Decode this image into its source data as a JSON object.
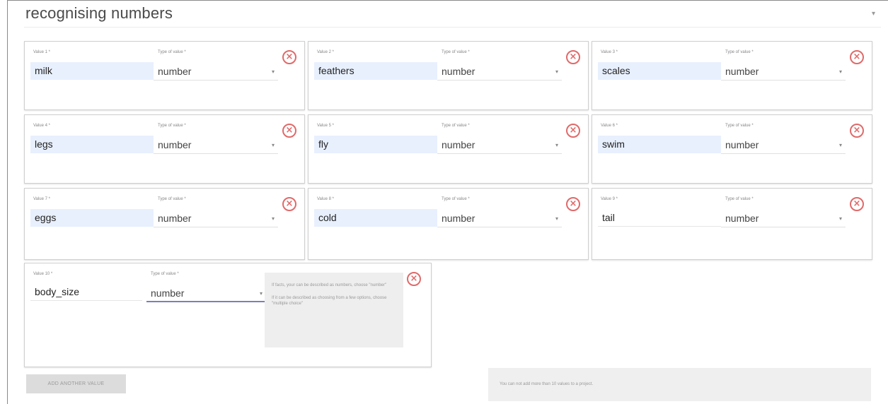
{
  "section": {
    "title": "recognising numbers",
    "collapse_icon": "▾"
  },
  "values": [
    {
      "label": "Value 1 *",
      "type_label": "Type of value *",
      "value": "milk",
      "type": "number"
    },
    {
      "label": "Value 2 *",
      "type_label": "Type of value *",
      "value": "feathers",
      "type": "number"
    },
    {
      "label": "Value 3 *",
      "type_label": "Type of value *",
      "value": "scales",
      "type": "number"
    },
    {
      "label": "Value 4 *",
      "type_label": "Type of value *",
      "value": "legs",
      "type": "number"
    },
    {
      "label": "Value 5 *",
      "type_label": "Type of value *",
      "value": "fly",
      "type": "number"
    },
    {
      "label": "Value 6 *",
      "type_label": "Type of value *",
      "value": "swim",
      "type": "number"
    },
    {
      "label": "Value 7 *",
      "type_label": "Type of value *",
      "value": "eggs",
      "type": "number"
    },
    {
      "label": "Value 8 *",
      "type_label": "Type of value *",
      "value": "cold",
      "type": "number"
    },
    {
      "label": "Value 9 *",
      "type_label": "Type of value *",
      "value": "tail",
      "type": "number"
    },
    {
      "label": "Value 10 *",
      "type_label": "Type of value *",
      "value": "body_size",
      "type": "number"
    }
  ],
  "tooltip": {
    "line1": "If facts, your can be described as numbers, choose \"number\"",
    "line2": "If it can be described as choosing from a few options, choose \"multiple choice\""
  },
  "add_button": "ADD ANOTHER VALUE",
  "notice": "You can not add more than 10 values to a project.",
  "colors": {
    "remove": "#e06a6a",
    "filled_input": "#e8f0fe",
    "active_underline": "#7a7fb8"
  }
}
